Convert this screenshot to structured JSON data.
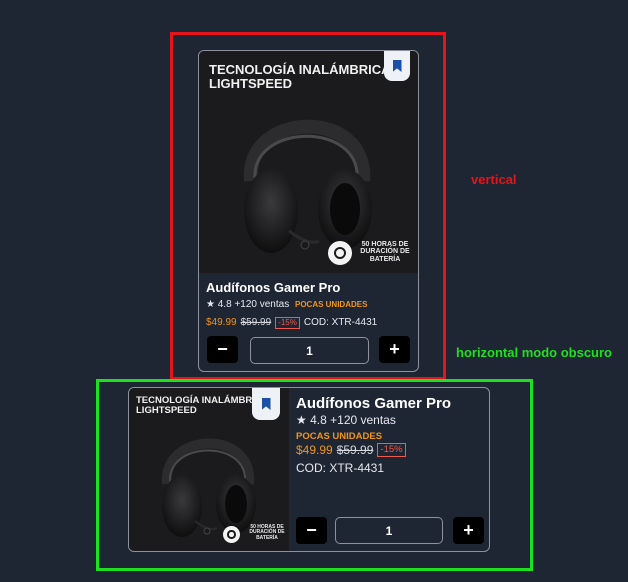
{
  "annotations": {
    "vertical_label": "vertical",
    "horizontal_label": "horizontal modo obscuro"
  },
  "product": {
    "image_headline_line1": "TECNOLOGÍA INALÁMBRICA",
    "image_headline_line2": "LIGHTSPEED",
    "image_badge": "50 HORAS DE\nDURACIÓN DE\nBATERÍA",
    "title": "Audífonos Gamer Pro",
    "rating_star": "★",
    "rating_value": "4.8",
    "sales": "+120 ventas",
    "stock_badge": "POCAS UNIDADES",
    "price": "$49.99",
    "old_price": "$59.99",
    "discount": "-15%",
    "sku": "COD: XTR-4431",
    "quantity": "1",
    "minus_label": "−",
    "plus_label": "+"
  },
  "colors": {
    "vertical_frame": "#e5131b",
    "horizontal_frame": "#1fe01f",
    "accent_orange": "#f0941c",
    "discount_red": "#f05a4a",
    "bookmark_blue": "#1b4fa8"
  },
  "icons": {
    "bookmark": "bookmark-icon",
    "star": "star-icon",
    "brand_logo": "logitech-g-logo"
  }
}
